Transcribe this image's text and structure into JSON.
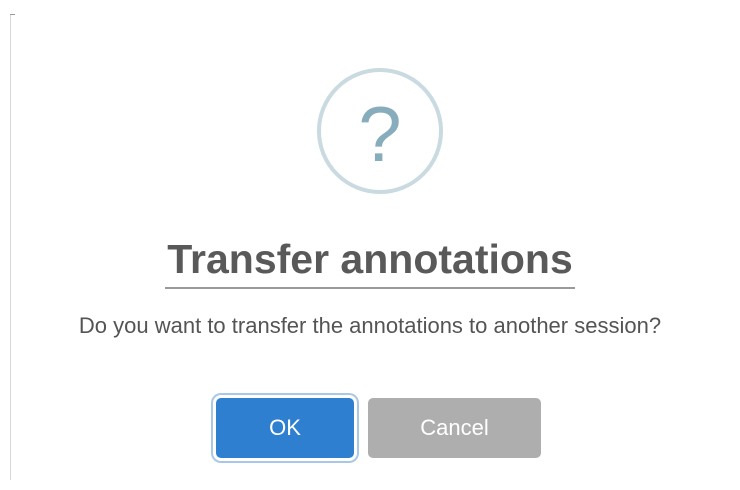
{
  "dialog": {
    "icon": "question-icon",
    "icon_glyph": "?",
    "title": "Transfer annotations",
    "message": "Do you want to transfer the annotations to another session?",
    "ok_label": "OK",
    "cancel_label": "Cancel"
  },
  "colors": {
    "ok_button": "#2f7fd0",
    "cancel_button": "#aeaeae",
    "icon_ring": "#c9dae1",
    "icon_glyph": "#87adbd",
    "title_text": "#595959"
  }
}
